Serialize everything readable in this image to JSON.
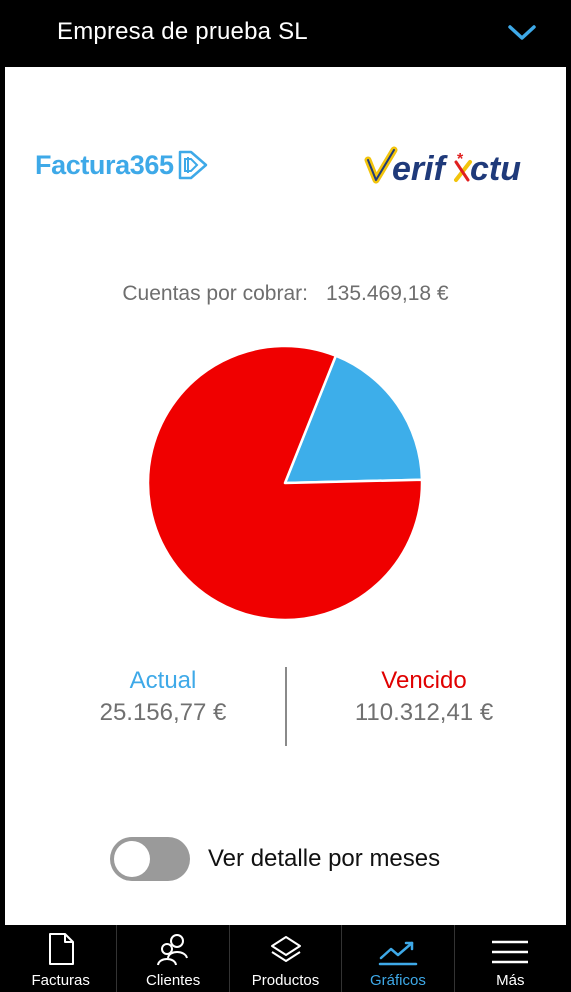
{
  "header": {
    "company": "Empresa de prueba SL",
    "expand_icon": "chevron-down-icon"
  },
  "logos": {
    "factura365": "Factura365",
    "verifactu": "Verifactu"
  },
  "summary": {
    "label": "Cuentas por cobrar:",
    "total": "135.469,18 €"
  },
  "chart_data": {
    "type": "pie",
    "labels": [
      "Actual",
      "Vencido"
    ],
    "values": [
      25156.77,
      110312.41
    ],
    "colors": [
      "#3daeea",
      "#f00000"
    ]
  },
  "stats": {
    "actual_label": "Actual",
    "actual_value": "25.156,77 €",
    "vencido_label": "Vencido",
    "vencido_value": "110.312,41 €"
  },
  "toggle": {
    "label": "Ver detalle por meses",
    "checked": false
  },
  "tabs": [
    {
      "label": "Facturas",
      "icon": "document-icon",
      "active": false
    },
    {
      "label": "Clientes",
      "icon": "users-icon",
      "active": false
    },
    {
      "label": "Productos",
      "icon": "layers-icon",
      "active": false
    },
    {
      "label": "Gráficos",
      "icon": "chart-line-icon",
      "active": true
    },
    {
      "label": "Más",
      "icon": "menu-icon",
      "active": false
    }
  ],
  "colors": {
    "accent_blue": "#3ea9e8",
    "overdue_red": "#e00000"
  }
}
